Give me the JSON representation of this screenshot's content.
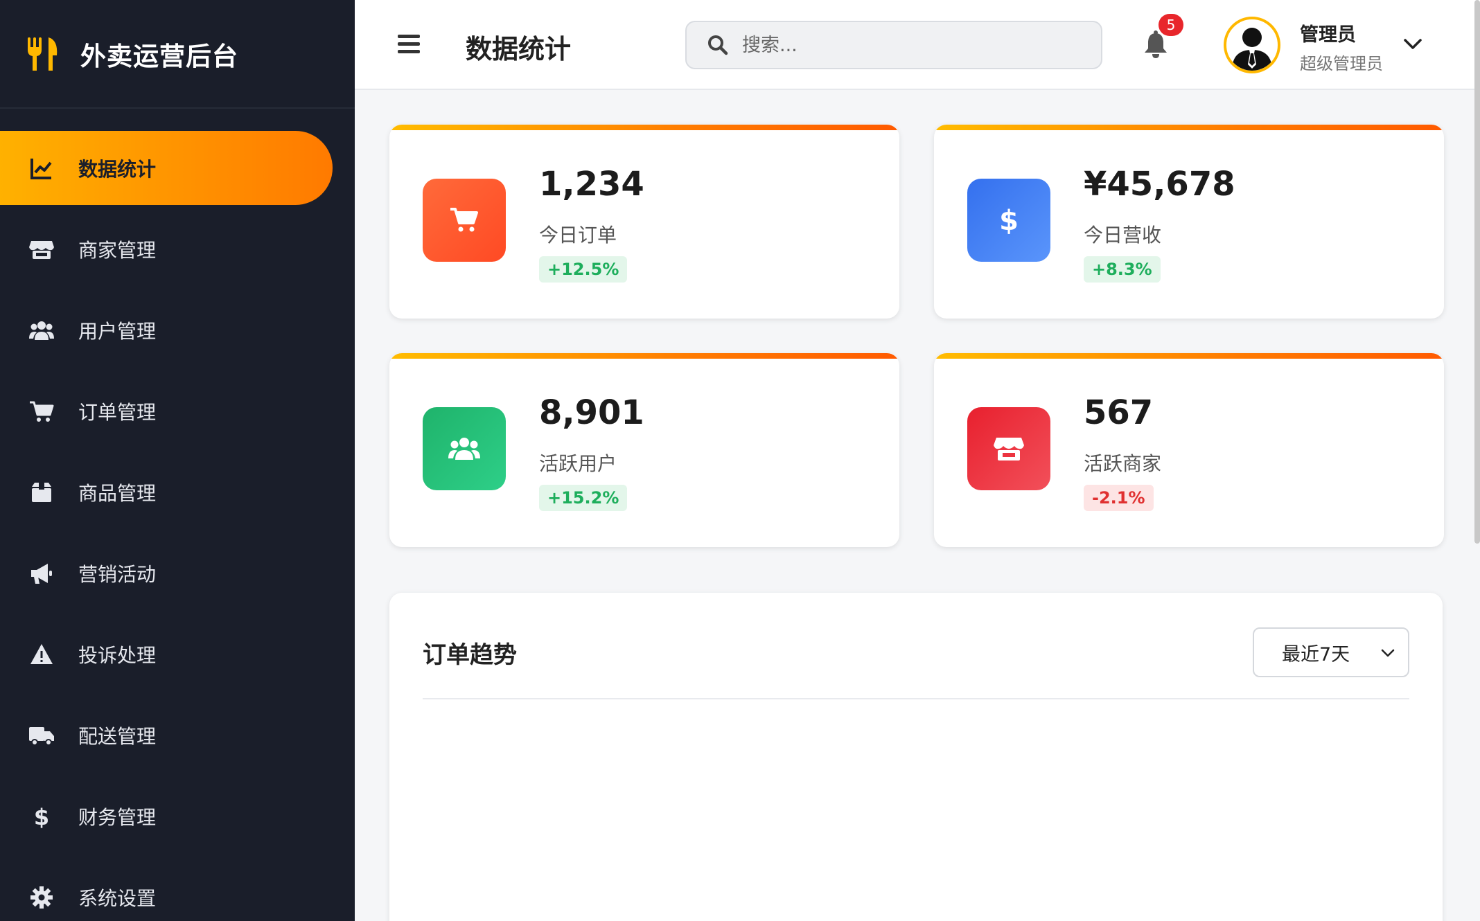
{
  "brand": {
    "title": "外卖运营后台",
    "icon": "fork-knife-icon"
  },
  "sidebar": {
    "items": [
      {
        "label": "数据统计",
        "icon": "chart-line-icon",
        "active": true
      },
      {
        "label": "商家管理",
        "icon": "store-icon",
        "active": false
      },
      {
        "label": "用户管理",
        "icon": "users-icon",
        "active": false
      },
      {
        "label": "订单管理",
        "icon": "cart-icon",
        "active": false
      },
      {
        "label": "商品管理",
        "icon": "box-icon",
        "active": false
      },
      {
        "label": "营销活动",
        "icon": "megaphone-icon",
        "active": false
      },
      {
        "label": "投诉处理",
        "icon": "warning-icon",
        "active": false
      },
      {
        "label": "配送管理",
        "icon": "truck-icon",
        "active": false
      },
      {
        "label": "财务管理",
        "icon": "dollar-icon",
        "active": false
      },
      {
        "label": "系统设置",
        "icon": "gear-icon",
        "active": false
      }
    ]
  },
  "header": {
    "title": "数据统计",
    "search_placeholder": "搜索...",
    "notification_count": "5",
    "user_name": "管理员",
    "user_role": "超级管理员"
  },
  "stats": [
    {
      "value": "1,234",
      "label": "今日订单",
      "trend": "+12.5%",
      "direction": "up",
      "icon": "cart-icon",
      "color": "#ff5a2e"
    },
    {
      "value": "¥45,678",
      "label": "今日营收",
      "trend": "+8.3%",
      "direction": "up",
      "icon": "dollar-icon",
      "color": "#3b7bf0"
    },
    {
      "value": "8,901",
      "label": "活跃用户",
      "trend": "+15.2%",
      "direction": "up",
      "icon": "users-icon",
      "color": "#22b872"
    },
    {
      "value": "567",
      "label": "活跃商家",
      "trend": "-2.1%",
      "direction": "down",
      "icon": "store-icon",
      "color": "#e8303a"
    }
  ],
  "chart_panel": {
    "title": "订单趋势",
    "range_selected": "最近7天"
  },
  "colors": {
    "accent_start": "#ffb100",
    "accent_end": "#ff7a00",
    "sidebar_bg": "#1a1e2a"
  }
}
